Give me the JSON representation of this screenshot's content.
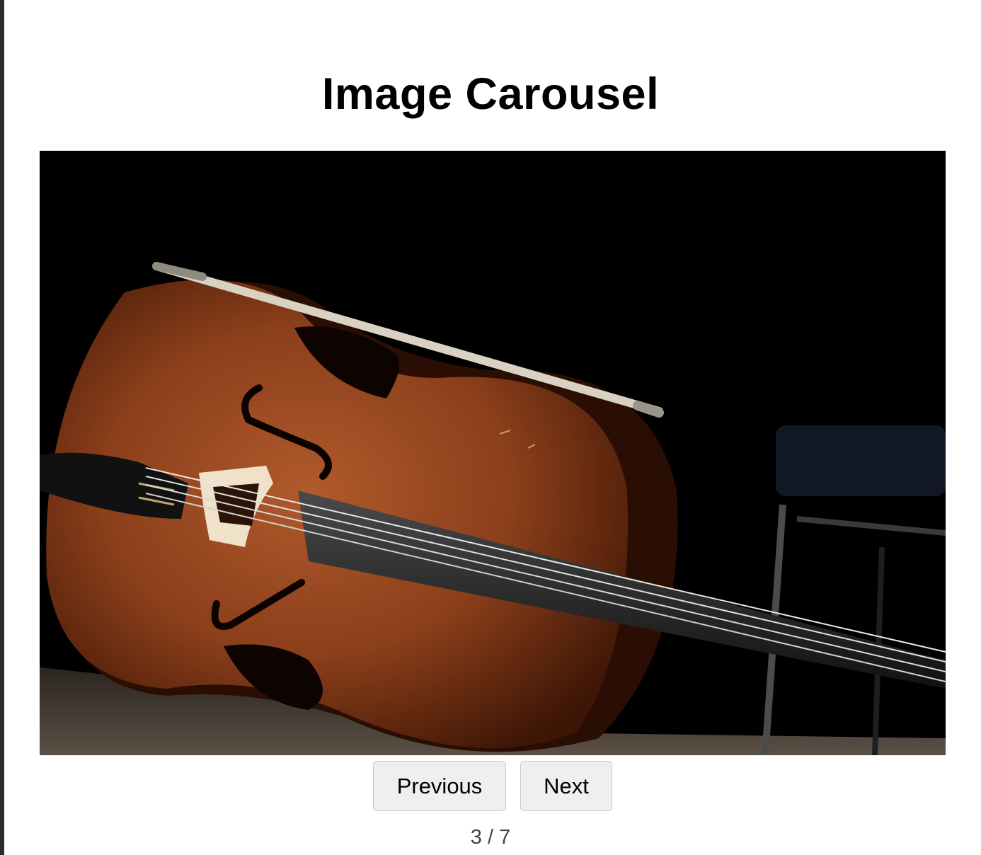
{
  "page": {
    "title": "Image Carousel"
  },
  "carousel": {
    "current_index": 3,
    "total": 7,
    "counter_text": "3 / 7",
    "slide_subject": "cello with bow on dark stage",
    "previous_label": "Previous",
    "next_label": "Next"
  },
  "colors": {
    "background": "#ffffff",
    "frame": "#000000",
    "button_bg": "#efefef",
    "button_border": "#c9c9c9",
    "counter_text": "#444444"
  }
}
